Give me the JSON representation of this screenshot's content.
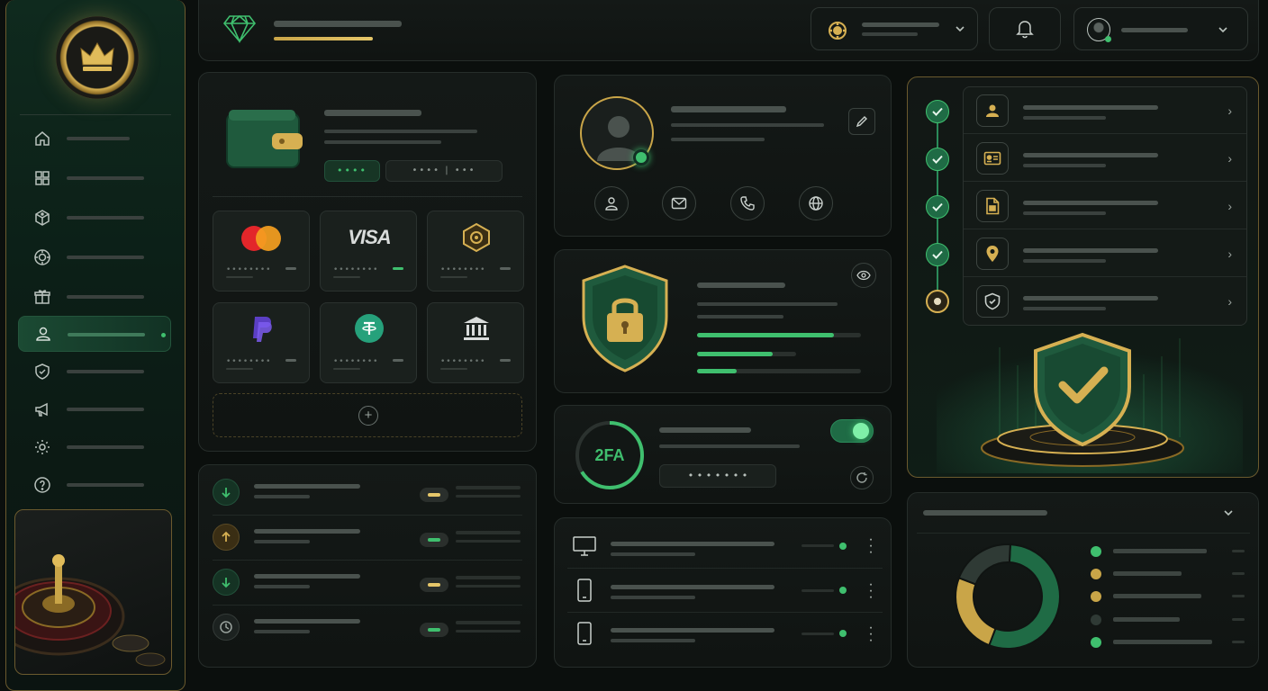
{
  "payment_cards": [
    {
      "name": "mastercard",
      "dots": "••••••••"
    },
    {
      "name": "visa",
      "label": "VISA",
      "dots": "••••••••"
    },
    {
      "name": "crypto-hex",
      "dots": "••••••••"
    },
    {
      "name": "paypal",
      "dots": "••••••••"
    },
    {
      "name": "tether",
      "dots": "••••••••"
    },
    {
      "name": "bank",
      "dots": "••••••••"
    }
  ],
  "wallet": {
    "pin_dots": "••••",
    "masked_account": "•••• | •••"
  },
  "two_factor": {
    "label": "2FA",
    "code_dots": "• • • • • • •",
    "toggle_on": true
  },
  "add_button": "+",
  "kyc_steps": [
    {
      "icon": "user-icon",
      "state": "done"
    },
    {
      "icon": "id-card-icon",
      "state": "done"
    },
    {
      "icon": "document-icon",
      "state": "done"
    },
    {
      "icon": "location-pin-icon",
      "state": "done"
    },
    {
      "icon": "shield-icon",
      "state": "current"
    }
  ],
  "chart_data": {
    "type": "pie",
    "values": [
      55,
      25,
      20
    ],
    "colors": [
      "#1f6b45",
      "#c9a548",
      "#2f3a35"
    ]
  },
  "colors": {
    "accent_gold": "#d6b052",
    "accent_green": "#3fbf6e",
    "bg": "#0b0f0d"
  }
}
